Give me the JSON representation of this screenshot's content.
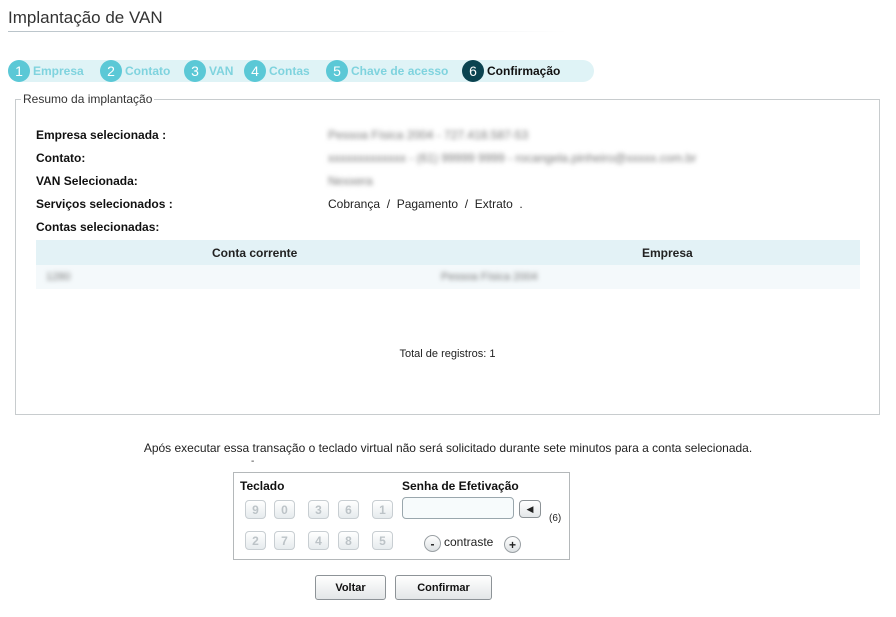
{
  "page": {
    "title": "Implantação de VAN"
  },
  "steps": [
    {
      "num": "1",
      "label": "Empresa"
    },
    {
      "num": "2",
      "label": "Contato"
    },
    {
      "num": "3",
      "label": "VAN"
    },
    {
      "num": "4",
      "label": "Contas"
    },
    {
      "num": "5",
      "label": "Chave de acesso"
    },
    {
      "num": "6",
      "label": "Confirmação"
    }
  ],
  "summary": {
    "legend": "Resumo da implantação",
    "empresa_label": "Empresa selecionada :",
    "empresa_value": "Pessoa Física 2004 - 727.418.587-53",
    "contato_label": "Contato:",
    "contato_value": "xxxxxxxxxxxxx - (61) 99999 9999 - rocangela.pinheiro@xxxxx.com.br",
    "van_label": "VAN Selecionada:",
    "van_value": "Nexxera",
    "servicos_label": "Serviços selecionados :",
    "servicos_value": "Cobrança  /  Pagamento  /  Extrato  .",
    "contas_label": "Contas selecionadas:",
    "table": {
      "col_conta": "Conta corrente",
      "col_empresa": "Empresa",
      "rows": [
        {
          "conta": "1280",
          "empresa": "Pessoa Física 2004"
        }
      ]
    },
    "total": "Total de registros: 1"
  },
  "note": "Após executar essa transação o teclado virtual não será solicitado durante sete minutos para a conta selecionada.",
  "note_mark": "-",
  "keypad": {
    "teclado_label": "Teclado",
    "senha_label": "Senha de Efetivação",
    "keys_row1": [
      "9",
      "0",
      "3",
      "6",
      "1"
    ],
    "keys_row2": [
      "2",
      "7",
      "4",
      "8",
      "5"
    ],
    "backspace_glyph": "◀",
    "count": "(6)",
    "minus_glyph": "-",
    "plus_glyph": "+",
    "contrast_label": "contraste"
  },
  "buttons": {
    "back": "Voltar",
    "confirm": "Confirmar"
  }
}
